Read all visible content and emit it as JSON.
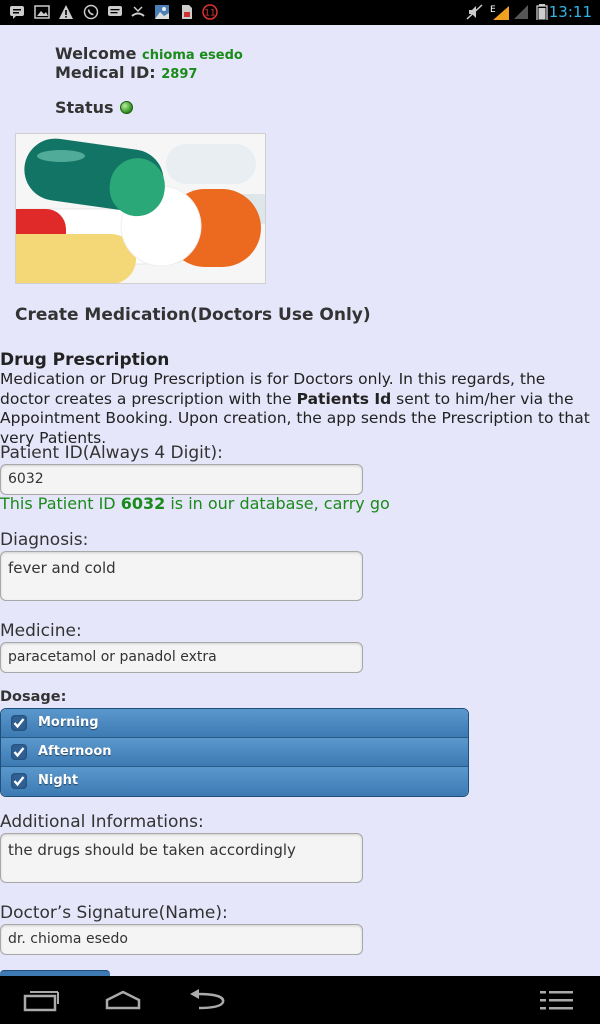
{
  "status_bar": {
    "time": "13:11",
    "notification_icons": [
      "message-icon",
      "image-icon",
      "warning-icon",
      "whatsapp-icon",
      "chat-icon",
      "missed-call-icon",
      "image2-icon",
      "sim-icon",
      "badge-icon"
    ],
    "badge_count": "11",
    "network_type": "E"
  },
  "header": {
    "welcome_label": "Welcome",
    "user_name": "chioma esedo",
    "medical_id_label": "Medical ID:",
    "medical_id": "2897",
    "status_label": "Status",
    "status_color": "#2e8b1f"
  },
  "page": {
    "create_title": "Create Medication(Doctors Use Only)",
    "section_title": "Drug Prescription",
    "description_part1": "Medication or Drug Prescription is for Doctors only. In this regards, the doctor creates a prescription with the ",
    "description_bold": "Patients Id",
    "description_part2": " sent to him/her via the Appointment Booking. Upon creation, the app sends the Prescription to that very Patients."
  },
  "form": {
    "patient_id_label": "Patient ID(Always 4 Digit):",
    "patient_id_value": "6032",
    "patient_msg_prefix": "This Patient ID ",
    "patient_msg_id": "6032",
    "patient_msg_suffix": " is in our database, carry go",
    "diagnosis_label": "Diagnosis:",
    "diagnosis_value": "fever and cold",
    "medicine_label": "Medicine:",
    "medicine_value": "paracetamol or panadol extra",
    "dosage_label": "Dosage:",
    "dosage_options": [
      {
        "label": "Morning",
        "checked": true
      },
      {
        "label": "Afternoon",
        "checked": true
      },
      {
        "label": "Night",
        "checked": true
      }
    ],
    "additional_label": "Additional Informations:",
    "additional_value": "the drugs should be taken accordingly",
    "signature_label": "Doctor’s Signature(Name):",
    "signature_value": "dr. chioma esedo"
  },
  "colors": {
    "background": "#e6e6fa",
    "accent_green": "#1a8a1a",
    "dosage_blue": "#3d7ab3",
    "clock_blue": "#33b5e5"
  }
}
